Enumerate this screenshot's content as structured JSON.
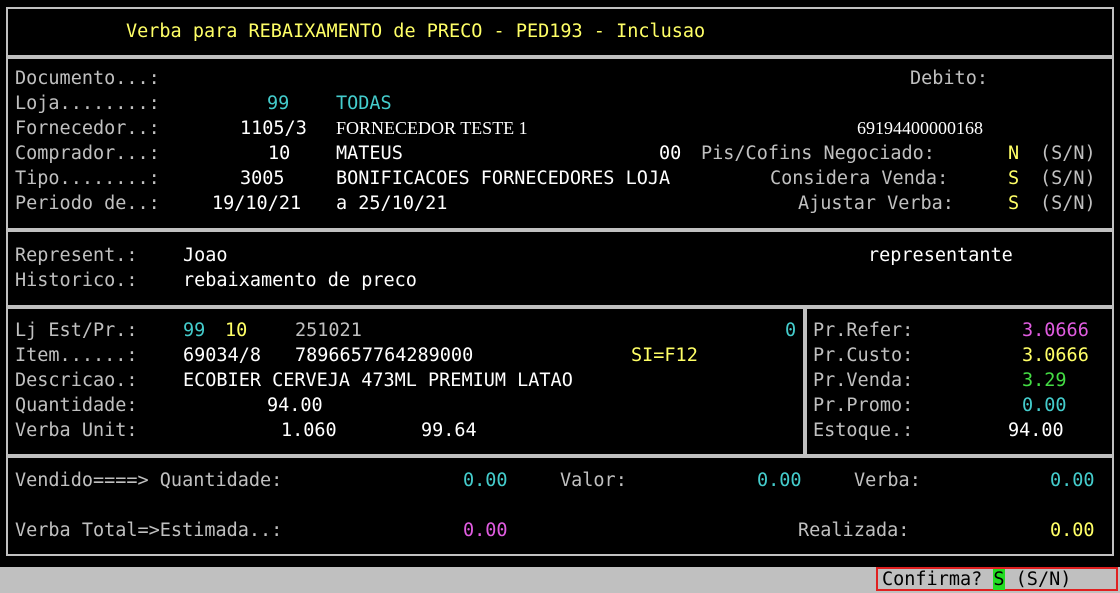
{
  "title": "Verba para REBAIXAMENTO de PRECO - PED193 - Inclusao",
  "header": {
    "documento_label": "Documento...:",
    "debito_label": "Debito:",
    "loja_label": "Loja........:",
    "loja_code": "99",
    "loja_name": "TODAS",
    "fornecedor_label": "Fornecedor..:",
    "fornecedor_code": "1105/3",
    "fornecedor_name": "FORNECEDOR TESTE 1",
    "fornecedor_cnpj": "69194400000168",
    "comprador_label": "Comprador...:",
    "comprador_code": "10",
    "comprador_name": "MATEUS",
    "pis_code": "00",
    "pis_label": "Pis/Cofins Negociado:",
    "pis_value": "N",
    "pis_opts": "(S/N)",
    "tipo_label": "Tipo........:",
    "tipo_code": "3005",
    "tipo_name": "BONIFICACOES FORNECEDORES LOJA",
    "considera_label": "Considera Venda:",
    "considera_value": "S",
    "considera_opts": "(S/N)",
    "periodo_label": "Periodo de..:",
    "periodo_de": "19/10/21",
    "periodo_a": "a 25/10/21",
    "ajustar_label": "Ajustar Verba:",
    "ajustar_value": "S",
    "ajustar_opts": "(S/N)"
  },
  "rep": {
    "represent_label": "Represent.:",
    "represent_value": "Joao",
    "represent_role": "representante",
    "historico_label": "Historico.:",
    "historico_value": "rebaixamento de preco"
  },
  "item": {
    "ljest_label": "Lj Est/Pr.:",
    "lj": "99",
    "est": "10",
    "date_code": "251021",
    "zero": "0",
    "item_label": "Item......:",
    "item_code": "69034/8",
    "ean": "7896657764289000",
    "si": "SI=F12",
    "descricao_label": "Descricao.:",
    "descricao": "ECOBIER CERVEJA 473ML PREMIUM LATAO",
    "quantidade_label": "Quantidade:",
    "quantidade": "94.00",
    "verba_unit_label": "Verba Unit:",
    "verba_unit": "1.060",
    "verba_unit_total": "99.64"
  },
  "prices": {
    "refer_label": "Pr.Refer:",
    "refer": "3.0666",
    "custo_label": "Pr.Custo:",
    "custo": "3.0666",
    "venda_label": "Pr.Venda:",
    "venda": "3.29",
    "promo_label": "Pr.Promo:",
    "promo": "0.00",
    "estoque_label": "Estoque.:",
    "estoque": "94.00"
  },
  "totals": {
    "vendido_label": "Vendido====> Quantidade:",
    "vendido_qtd": "0.00",
    "valor_label": "Valor:",
    "valor": "0.00",
    "verba_label": "Verba:",
    "verba": "0.00",
    "verba_total_label": "Verba Total=>Estimada..:",
    "estimada": "0.00",
    "realizada_label": "Realizada:",
    "realizada": "0.00"
  },
  "status": {
    "confirm_label": "Confirma?",
    "confirm_value": "S",
    "confirm_opts": "(S/N)"
  },
  "colors": {
    "background": "#000000",
    "label": "#c0c0c0",
    "title": "#ffff66",
    "cyan": "#44cccc",
    "magenta": "#e05ce0",
    "green": "#44dd44",
    "confirm_border": "#e02020"
  }
}
